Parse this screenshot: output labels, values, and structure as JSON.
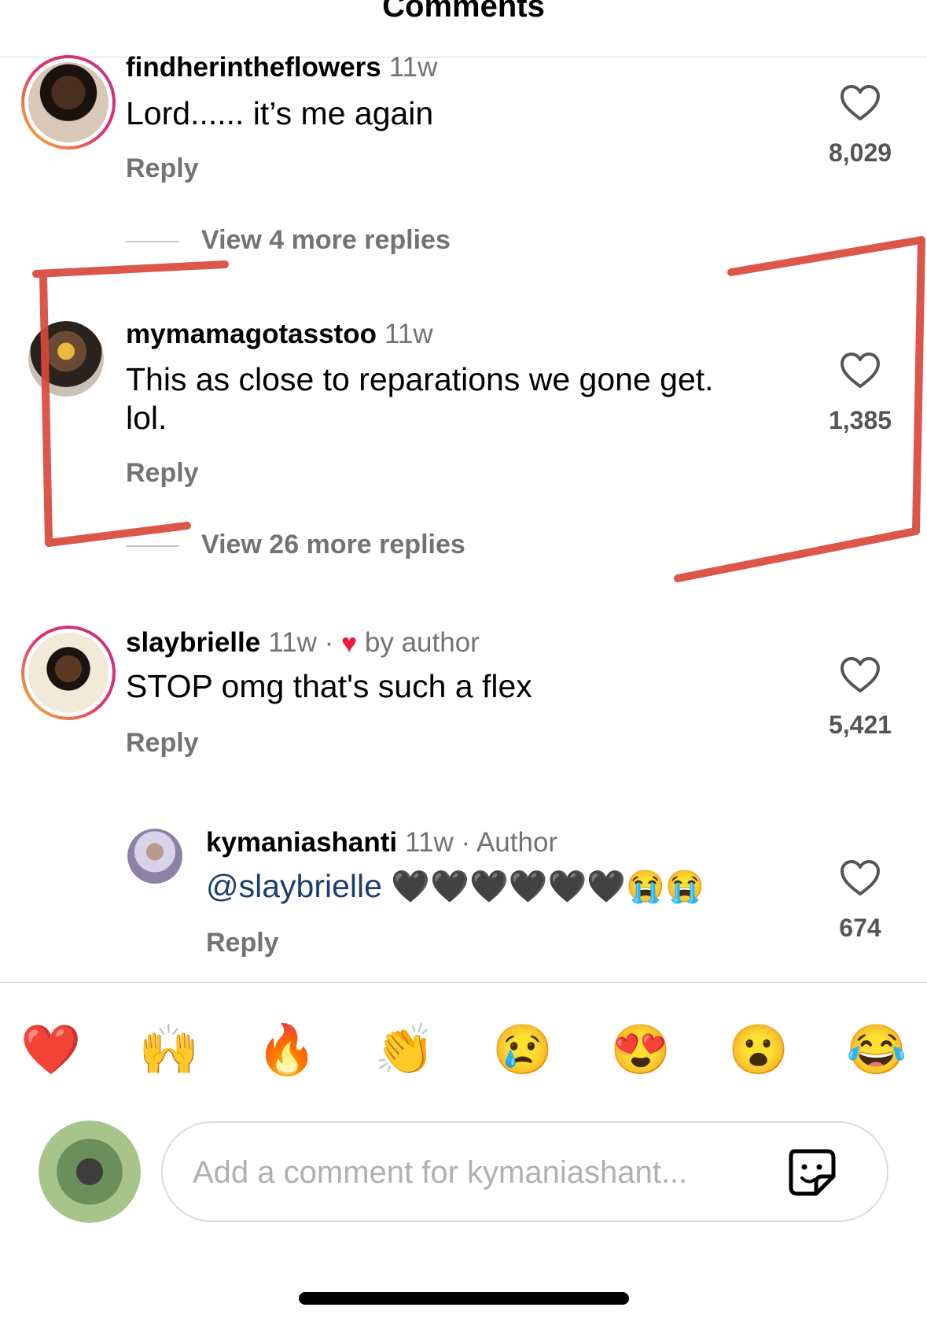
{
  "header": {
    "title": "Comments"
  },
  "comments": [
    {
      "username": "findherintheflowers",
      "time": "11w",
      "text": "Lord...... it’s me again",
      "reply": "Reply",
      "likes": "8,029",
      "view_more": "View 4 more replies"
    },
    {
      "username": "mymamagotasstoo",
      "time": "11w",
      "text": "This as close to reparations we gone get. lol.",
      "reply": "Reply",
      "likes": "1,385",
      "view_more": "View 26 more replies"
    },
    {
      "username": "slaybrielle",
      "time": "11w",
      "sep": "·",
      "by_author": "by author",
      "text": "STOP omg that's such a flex",
      "reply": "Reply",
      "likes": "5,421"
    },
    {
      "username": "kymaniashanti",
      "time": "11w",
      "author_tag": "· Author",
      "mention": "@slaybrielle",
      "emojis": "🖤🖤🖤🖤🖤🖤😭😭",
      "reply": "Reply",
      "likes": "674"
    }
  ],
  "quick_emojis": [
    "❤️",
    "🙌",
    "🔥",
    "👏",
    "😢",
    "😍",
    "😮",
    "😂"
  ],
  "composer": {
    "placeholder": "Add a comment for kymaniashant..."
  },
  "colors": {
    "annotation": "#d9483b",
    "mention": "#1e3d6b",
    "ring_start": "#f9c22e",
    "ring_end": "#c13584"
  },
  "icons": {
    "like": "heart-outline-icon",
    "sticker": "sticker-icon"
  }
}
